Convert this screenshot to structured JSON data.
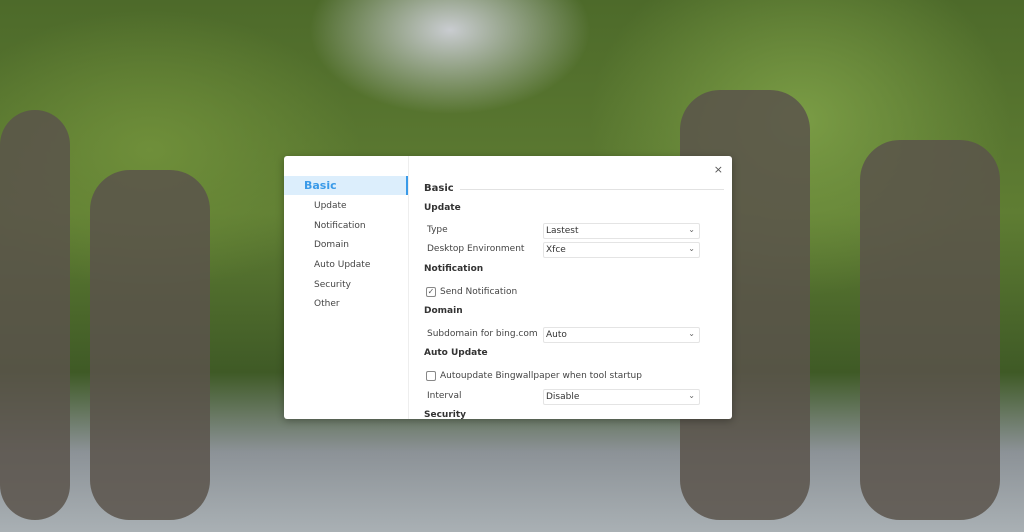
{
  "dialog": {
    "close_icon": "×",
    "sidebar": {
      "items": [
        {
          "label": "Basic"
        },
        {
          "label": "Update"
        },
        {
          "label": "Notification"
        },
        {
          "label": "Domain"
        },
        {
          "label": "Auto Update"
        },
        {
          "label": "Security"
        },
        {
          "label": "Other"
        }
      ]
    },
    "content": {
      "title": "Basic",
      "update": {
        "heading": "Update",
        "type_label": "Type",
        "type_value": "Lastest",
        "desktop_label": "Desktop Environment",
        "desktop_value": "Xfce"
      },
      "notification": {
        "heading": "Notification",
        "send_label": "Send Notification",
        "send_checked": true,
        "check_glyph": "✓"
      },
      "domain": {
        "heading": "Domain",
        "subdomain_label": "Subdomain for bing.com",
        "subdomain_value": "Auto"
      },
      "auto_update": {
        "heading": "Auto Update",
        "autoupdate_label": "Autoupdate Bingwallpaper when tool startup",
        "autoupdate_checked": false,
        "interval_label": "Interval",
        "interval_value": "Disable"
      },
      "security": {
        "heading": "Security"
      },
      "chevron": "⌄"
    }
  }
}
